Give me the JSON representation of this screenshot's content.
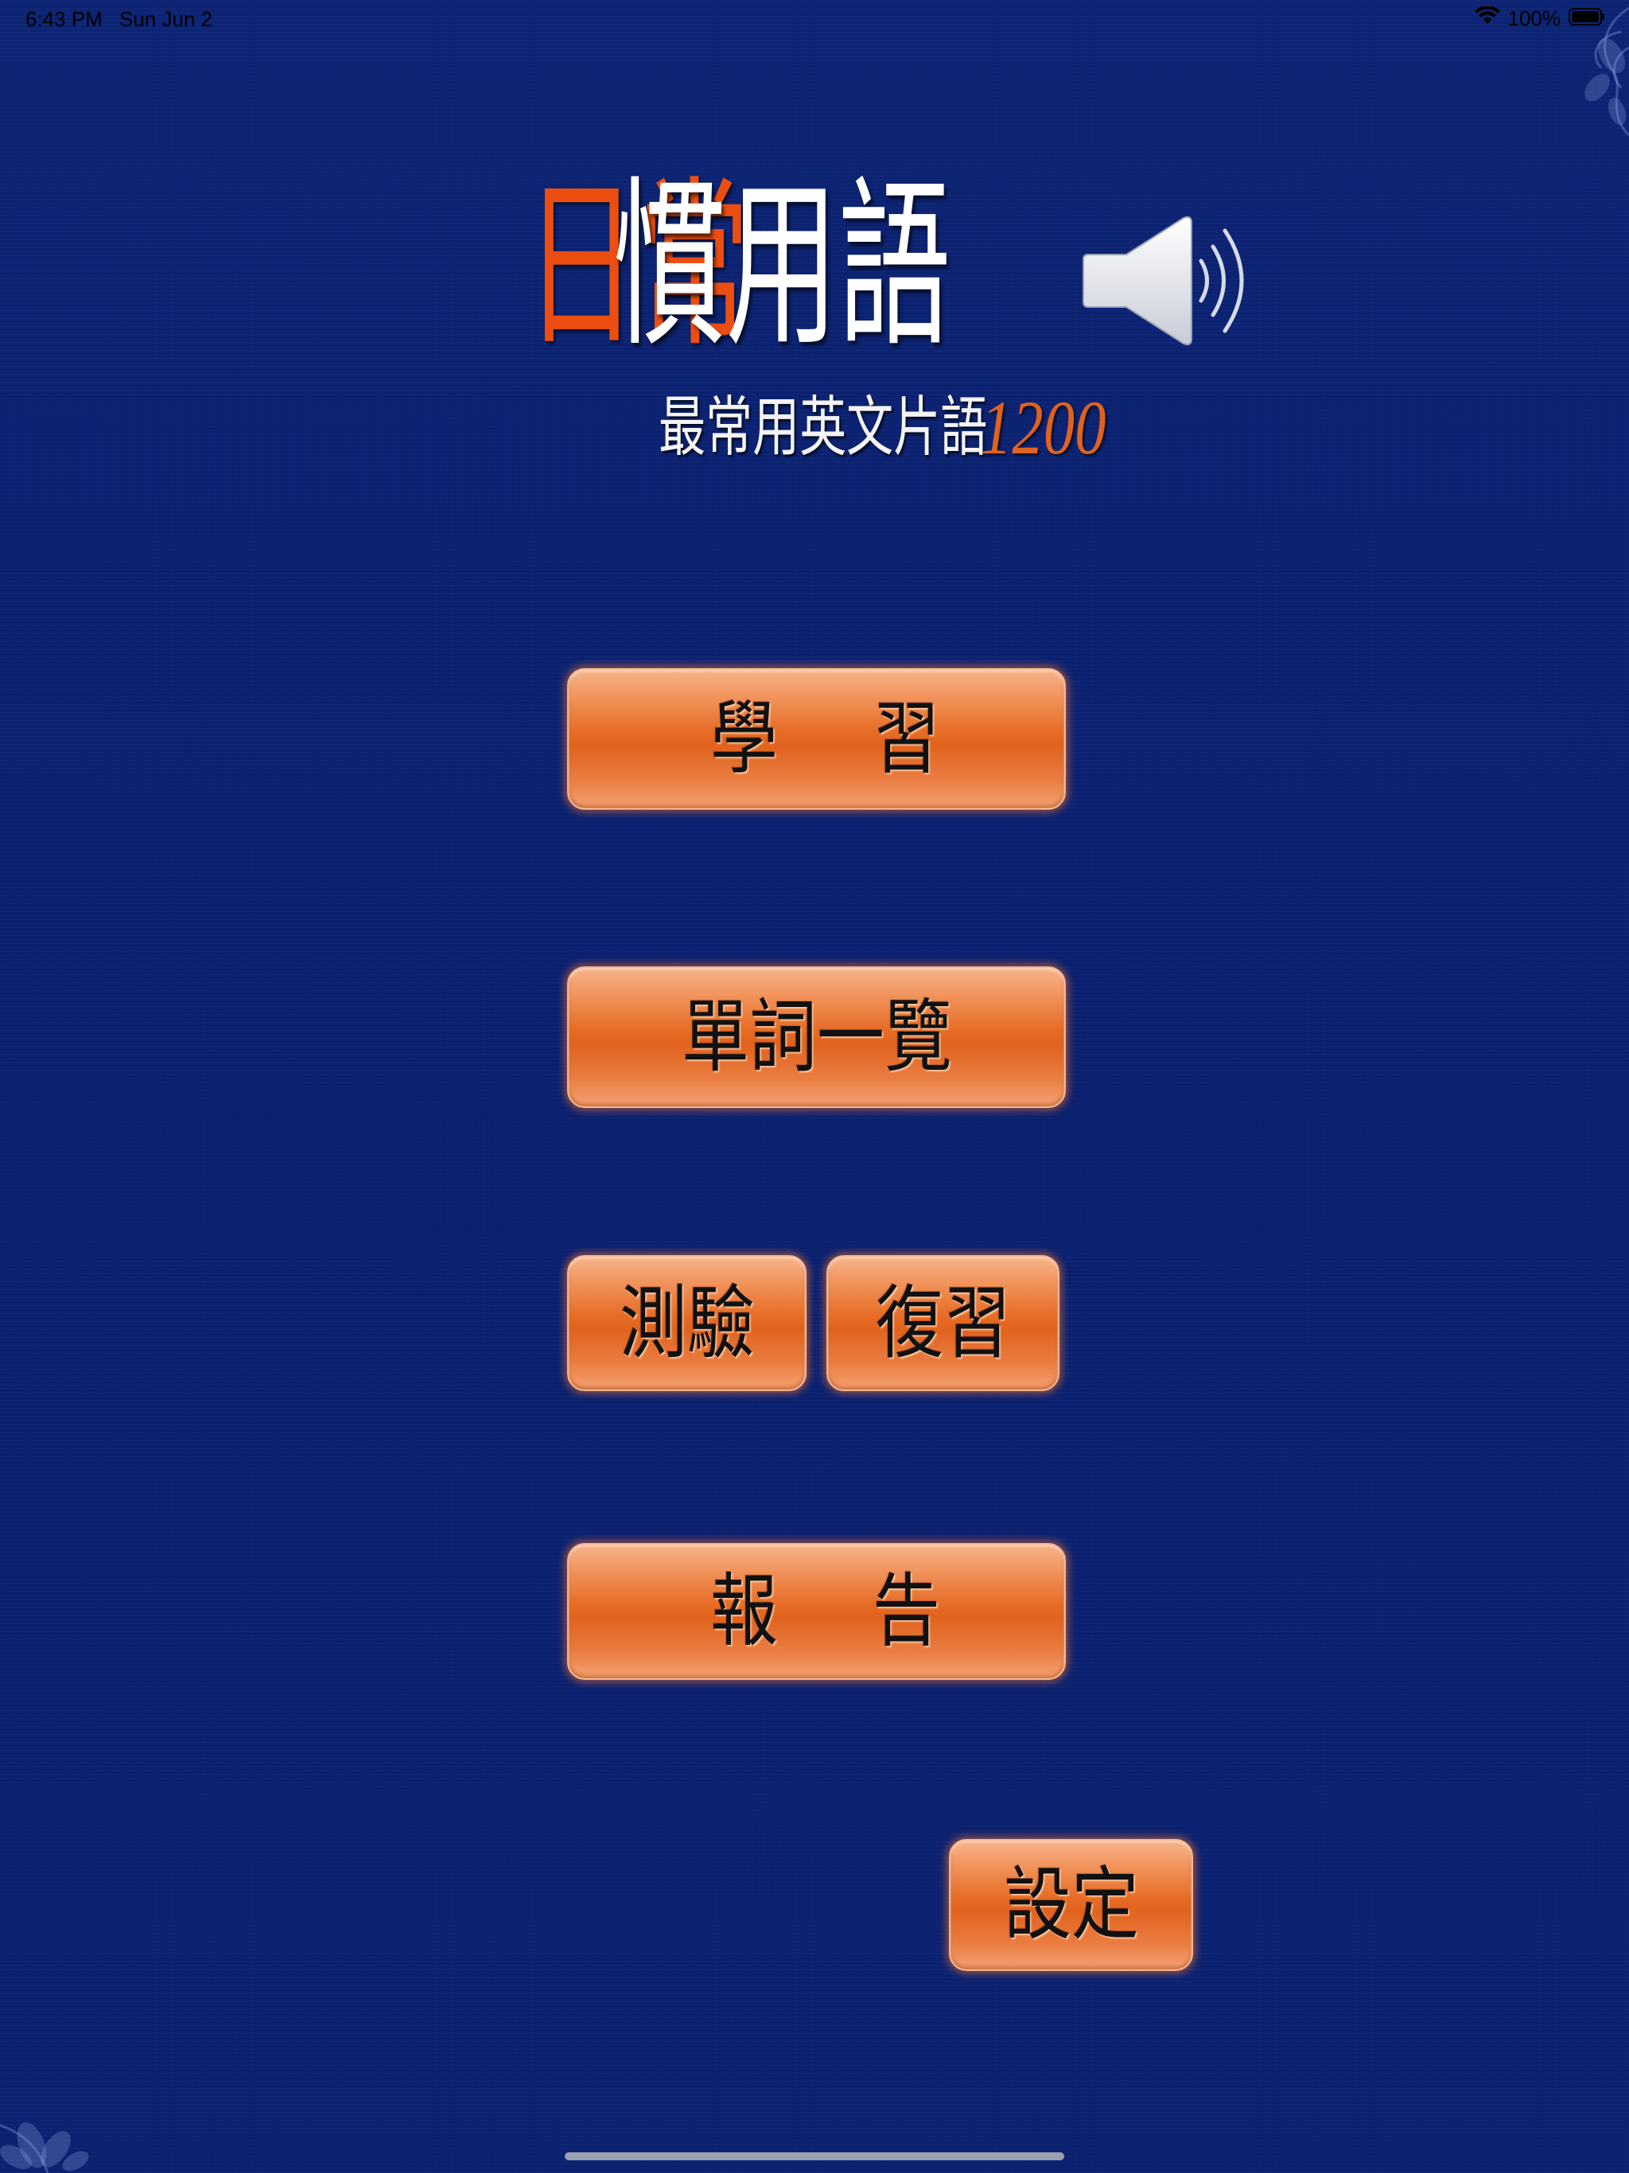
{
  "status_bar": {
    "time": "6:43 PM",
    "date": "Sun Jun 2",
    "battery": "100%"
  },
  "title": {
    "orange_part": "日常",
    "white_part": "慣用語",
    "subtitle_text": "最常用英文片語",
    "subtitle_number": "1200"
  },
  "buttons": {
    "learn": "學習",
    "word_list": "單詞一覽",
    "test": "測驗",
    "review": "復習",
    "report": "報告",
    "settings": "設定"
  },
  "colors": {
    "background": "#0b2272",
    "accent_orange": "#e66c25",
    "title_orange": "#ec4e12"
  },
  "icons": {
    "speaker": "speaker-icon",
    "wifi": "wifi-icon",
    "battery": "battery-icon"
  }
}
